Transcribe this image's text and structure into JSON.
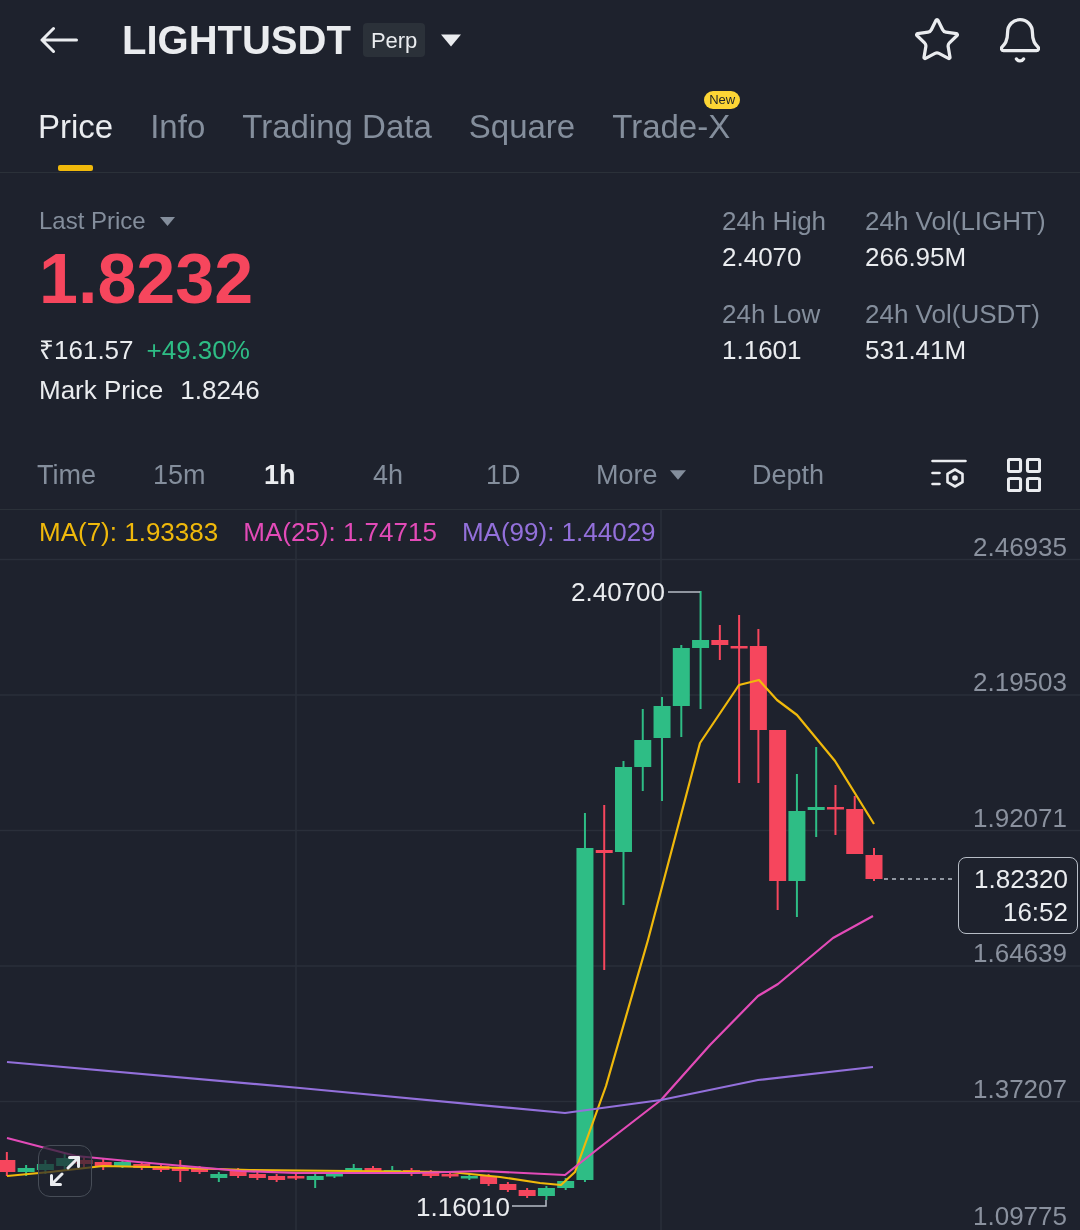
{
  "header": {
    "title": "LIGHTUSDT",
    "badge": "Perp"
  },
  "tabs": [
    {
      "label": "Price",
      "selected": true
    },
    {
      "label": "Info",
      "selected": false
    },
    {
      "label": "Trading Data",
      "selected": false
    },
    {
      "label": "Square",
      "selected": false
    },
    {
      "label": "Trade-X",
      "selected": false,
      "badge": "New"
    }
  ],
  "ticker": {
    "label": "Last Price",
    "last_price": "1.8232",
    "falling": true,
    "fiat_price": "₹161.57",
    "change": "+49.30%",
    "change_falling": false,
    "mark_label": "Mark Price",
    "mark_price": "1.8246"
  },
  "stats": [
    {
      "label": "24h High",
      "value": "2.4070"
    },
    {
      "label": "24h Vol(LIGHT)",
      "value": "266.95M"
    },
    {
      "label": "24h Low",
      "value": "1.1601"
    },
    {
      "label": "24h Vol(USDT)",
      "value": "531.41M"
    }
  ],
  "intervals": [
    {
      "label": "Time",
      "kind": "option",
      "selected": false
    },
    {
      "label": "15m",
      "kind": "option",
      "selected": false
    },
    {
      "label": "1h",
      "kind": "option",
      "selected": true
    },
    {
      "label": "4h",
      "kind": "option",
      "selected": false
    },
    {
      "label": "1D",
      "kind": "option",
      "selected": false
    },
    {
      "label": "More",
      "kind": "dropdown",
      "selected": false
    },
    {
      "label": "Depth",
      "kind": "option",
      "selected": false
    }
  ],
  "chart": {
    "indicators": [
      {
        "label": "MA(7): 1.93383",
        "color": "#f0b90b"
      },
      {
        "label": "MA(25): 1.74715",
        "color": "#e34bb8"
      },
      {
        "label": "MA(99): 1.44029",
        "color": "#9370db"
      }
    ],
    "price_axis": [
      "2.46935",
      "2.19503",
      "1.92071",
      "1.64639",
      "1.37207",
      "1.09775"
    ],
    "high_marker": "2.40700",
    "low_marker": "1.16010",
    "last_price_tag": {
      "price": "1.82320",
      "countdown": "16:52"
    }
  }
}
